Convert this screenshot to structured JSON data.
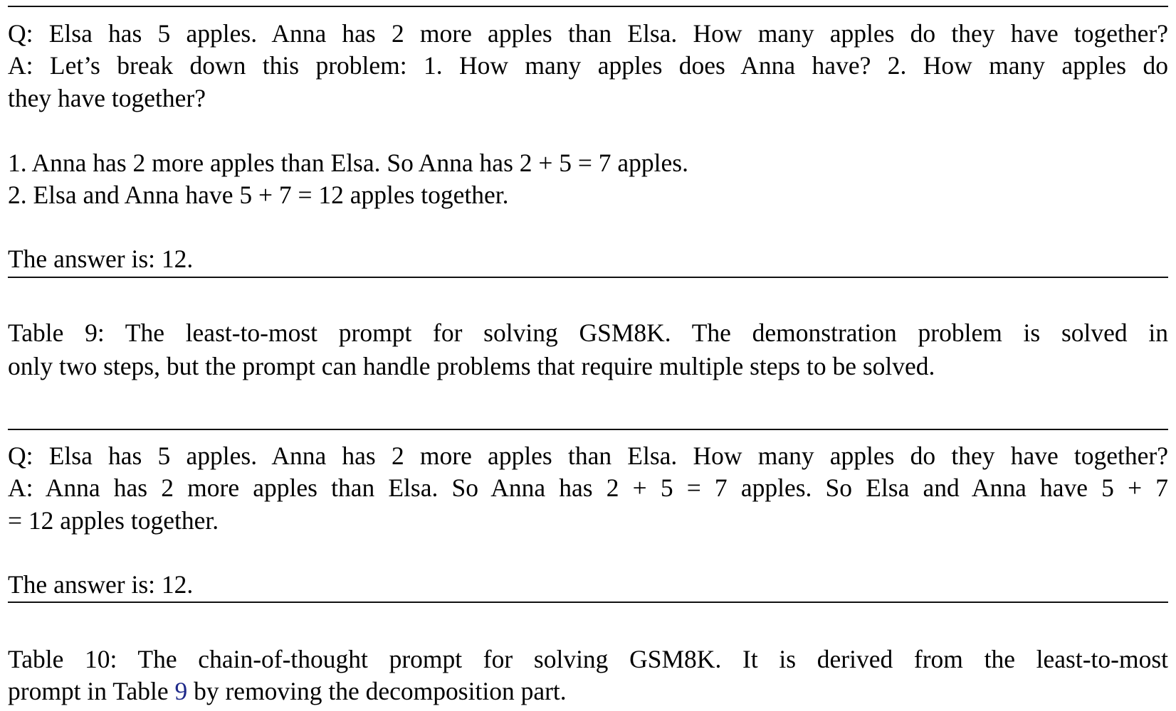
{
  "table9": {
    "prompt_lines": [
      "Q: Elsa has 5 apples. Anna has 2 more apples than Elsa. How many apples do they have together?",
      "A: Let’s break down this problem: 1. How many apples does Anna have? 2. How many apples do",
      "they have together?",
      "1. Anna has 2 more apples than Elsa. So Anna has 2 + 5 = 7 apples.",
      "2. Elsa and Anna have 5 + 7 = 12 apples together.",
      "The answer is: 12."
    ],
    "caption_lines": [
      "Table 9: The least-to-most prompt for solving GSM8K. The demonstration problem is solved in",
      "only two steps, but the prompt can handle problems that require multiple steps to be solved."
    ]
  },
  "table10": {
    "prompt_lines": [
      "Q: Elsa has 5 apples. Anna has 2 more apples than Elsa. How many apples do they have together?",
      "A: Anna has 2 more apples than Elsa. So Anna has 2 + 5 = 7 apples. So Elsa and Anna have 5 + 7",
      "= 12 apples together.",
      "The answer is: 12."
    ],
    "caption_line1": "Table 10: The chain-of-thought prompt for solving GSM8K. It is derived from the least-to-most",
    "caption_line2_before": "prompt in Table ",
    "caption_line2_ref": "9",
    "caption_line2_after": " by removing the decomposition part."
  },
  "colors": {
    "link": "#1f2a8a"
  }
}
